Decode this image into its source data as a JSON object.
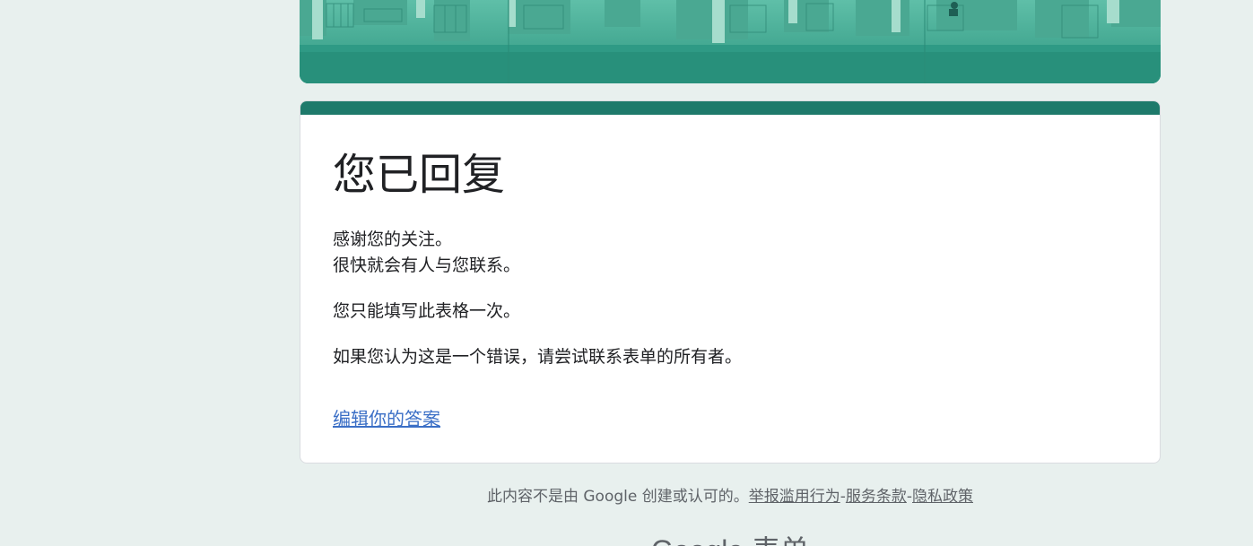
{
  "card": {
    "title": "您已回复",
    "thanks_line_1": "感谢您的关注。",
    "thanks_line_2": "很快就会有人与您联系。",
    "once_notice": "您只能填写此表格一次。",
    "error_notice": "如果您认为这是一个错误，请尝试联系表单的所有者。",
    "edit_link": "编辑你的答案"
  },
  "footer": {
    "disclaimer": "此内容不是由 Google 创建或认可的。",
    "report_abuse": "举报滥用行为",
    "separator": "-",
    "terms": "服务条款",
    "privacy": "隐私政策"
  },
  "brand": {
    "name": "Google 表单"
  },
  "colors": {
    "theme": "#1e7a6b",
    "banner": "#2f9a85",
    "background": "#e8f0ee",
    "link": "#3b6fc6"
  },
  "icons": {
    "banner": "city-skyline-illustration"
  }
}
